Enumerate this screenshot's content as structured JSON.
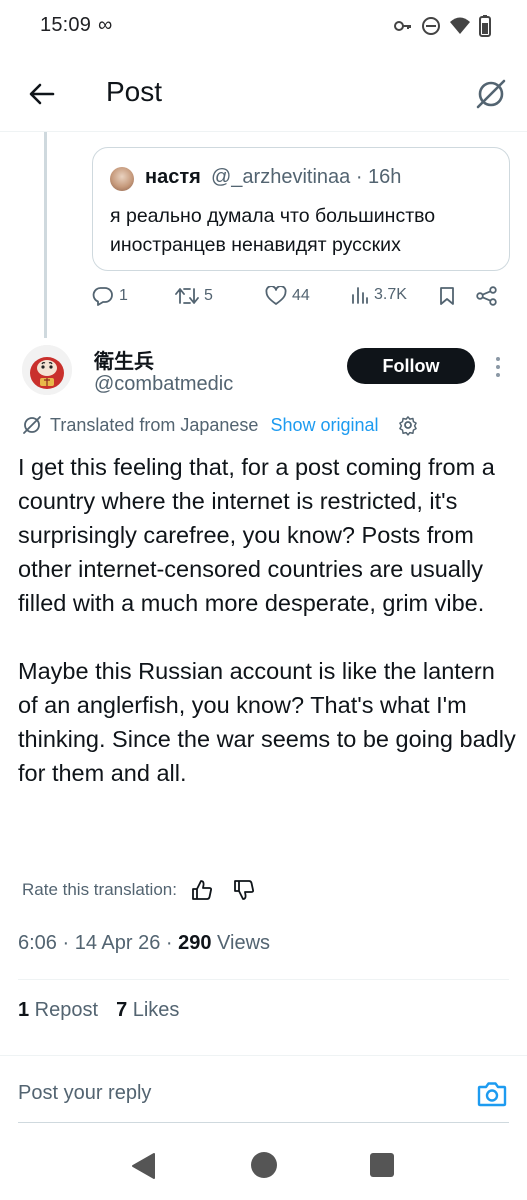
{
  "status_bar": {
    "time": "15:09",
    "link_symbol": "∞"
  },
  "header": {
    "title": "Post"
  },
  "quoted_post": {
    "author_name": "настя",
    "author_handle": "@_arzhevitinaa · 16h",
    "text": "я реально думала что большинство иностранцев ненавидят русских"
  },
  "actions": {
    "replies": "1",
    "reposts": "5",
    "likes": "44",
    "views": "3.7K"
  },
  "post": {
    "author_name": "衛生兵",
    "author_handle": "@combatmedic",
    "follow_label": "Follow",
    "translated_label": "Translated from Japanese",
    "show_original_label": "Show original",
    "paragraph_1": "I get this feeling that, for a post coming from a country where the internet is restricted, it's surprisingly carefree, you know? Posts from other internet-censored countries are usually filled with a much more desperate, grim vibe.",
    "paragraph_2": "Maybe this Russian account is like the lantern of an anglerfish, you know? That's what I'm thinking. Since the war seems to be going badly for them and all.",
    "rate_label": "Rate this translation:",
    "time_date": "6:06 · 14 Apr 26 · ",
    "views_count": "290",
    "views_label": " Views",
    "repost_count": "1",
    "repost_label": " Repost",
    "likes_count": "7",
    "likes_label": " Likes"
  },
  "reply_bar": {
    "placeholder": "Post your reply"
  },
  "colors": {
    "text_primary": "#0f1419",
    "text_secondary": "#536471",
    "accent_blue": "#1d9bf0",
    "border": "#cfd9de"
  },
  "icons": [
    "arrow-left-icon",
    "grok-icon",
    "reply-icon",
    "repost-icon",
    "heart-icon",
    "views-icon",
    "bookmark-icon",
    "share-icon",
    "translate-icon",
    "settings-icon",
    "thumbs-up-icon",
    "thumbs-down-icon",
    "camera-icon"
  ]
}
